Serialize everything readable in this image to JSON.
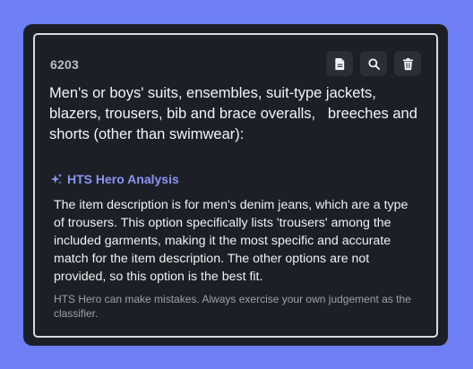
{
  "item": {
    "code": "6203",
    "description": "Men's or boys' suits, ensembles, suit-type jackets, blazers, trousers, bib and brace overalls,   breeches and shorts (other than swimwear):"
  },
  "actions": {
    "document_icon": "document-icon",
    "search_icon": "search-icon",
    "delete_icon": "trash-icon"
  },
  "analysis": {
    "icon": "sparkle-icon",
    "title": "HTS Hero Analysis",
    "body": "The item description is for men's denim jeans, which are a type of trousers. This option specifically lists 'trousers' among the included garments, making it the most specific and accurate match for the item description. The other options are not provided, so this option is the best fit.",
    "disclaimer": "HTS Hero can make mistakes. Always exercise your own judgement as the classifier."
  },
  "colors": {
    "page_background": "#6d7ff2",
    "card_background": "#1c2026",
    "accent": "#8a95f4"
  }
}
